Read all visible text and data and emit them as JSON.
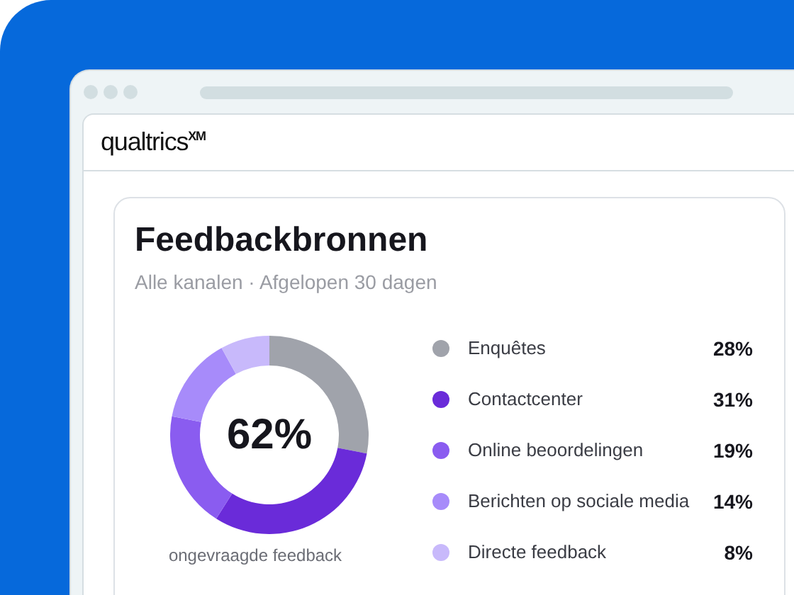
{
  "logo": "qualtrics$^{XM}$",
  "card": {
    "title": "Feedbackbronnen",
    "subtitle": "Alle kanalen · Afgelopen 30 dagen",
    "donut": {
      "center": "62%",
      "caption": "ongevraagde feedback",
      "chart_data": {
        "type": "donut",
        "categories": [
          "Enquêtes",
          "Contactcenter",
          "Online beoordelingen",
          "Berichten op sociale media",
          "Directe feedback"
        ],
        "values": [
          28,
          31,
          19,
          14,
          8
        ]
      }
    },
    "legend": [
      {
        "value": "28%",
        "color": "#a0a3ab"
      },
      {
        "value": "31%",
        "color": "#6a2bd9"
      },
      {
        "value": "19%",
        "color": "#8a5cf0"
      },
      {
        "value": "14%",
        "color": "#a78bfa"
      },
      {
        "value": "8%",
        "color": "#c8b9fb"
      }
    ]
  }
}
